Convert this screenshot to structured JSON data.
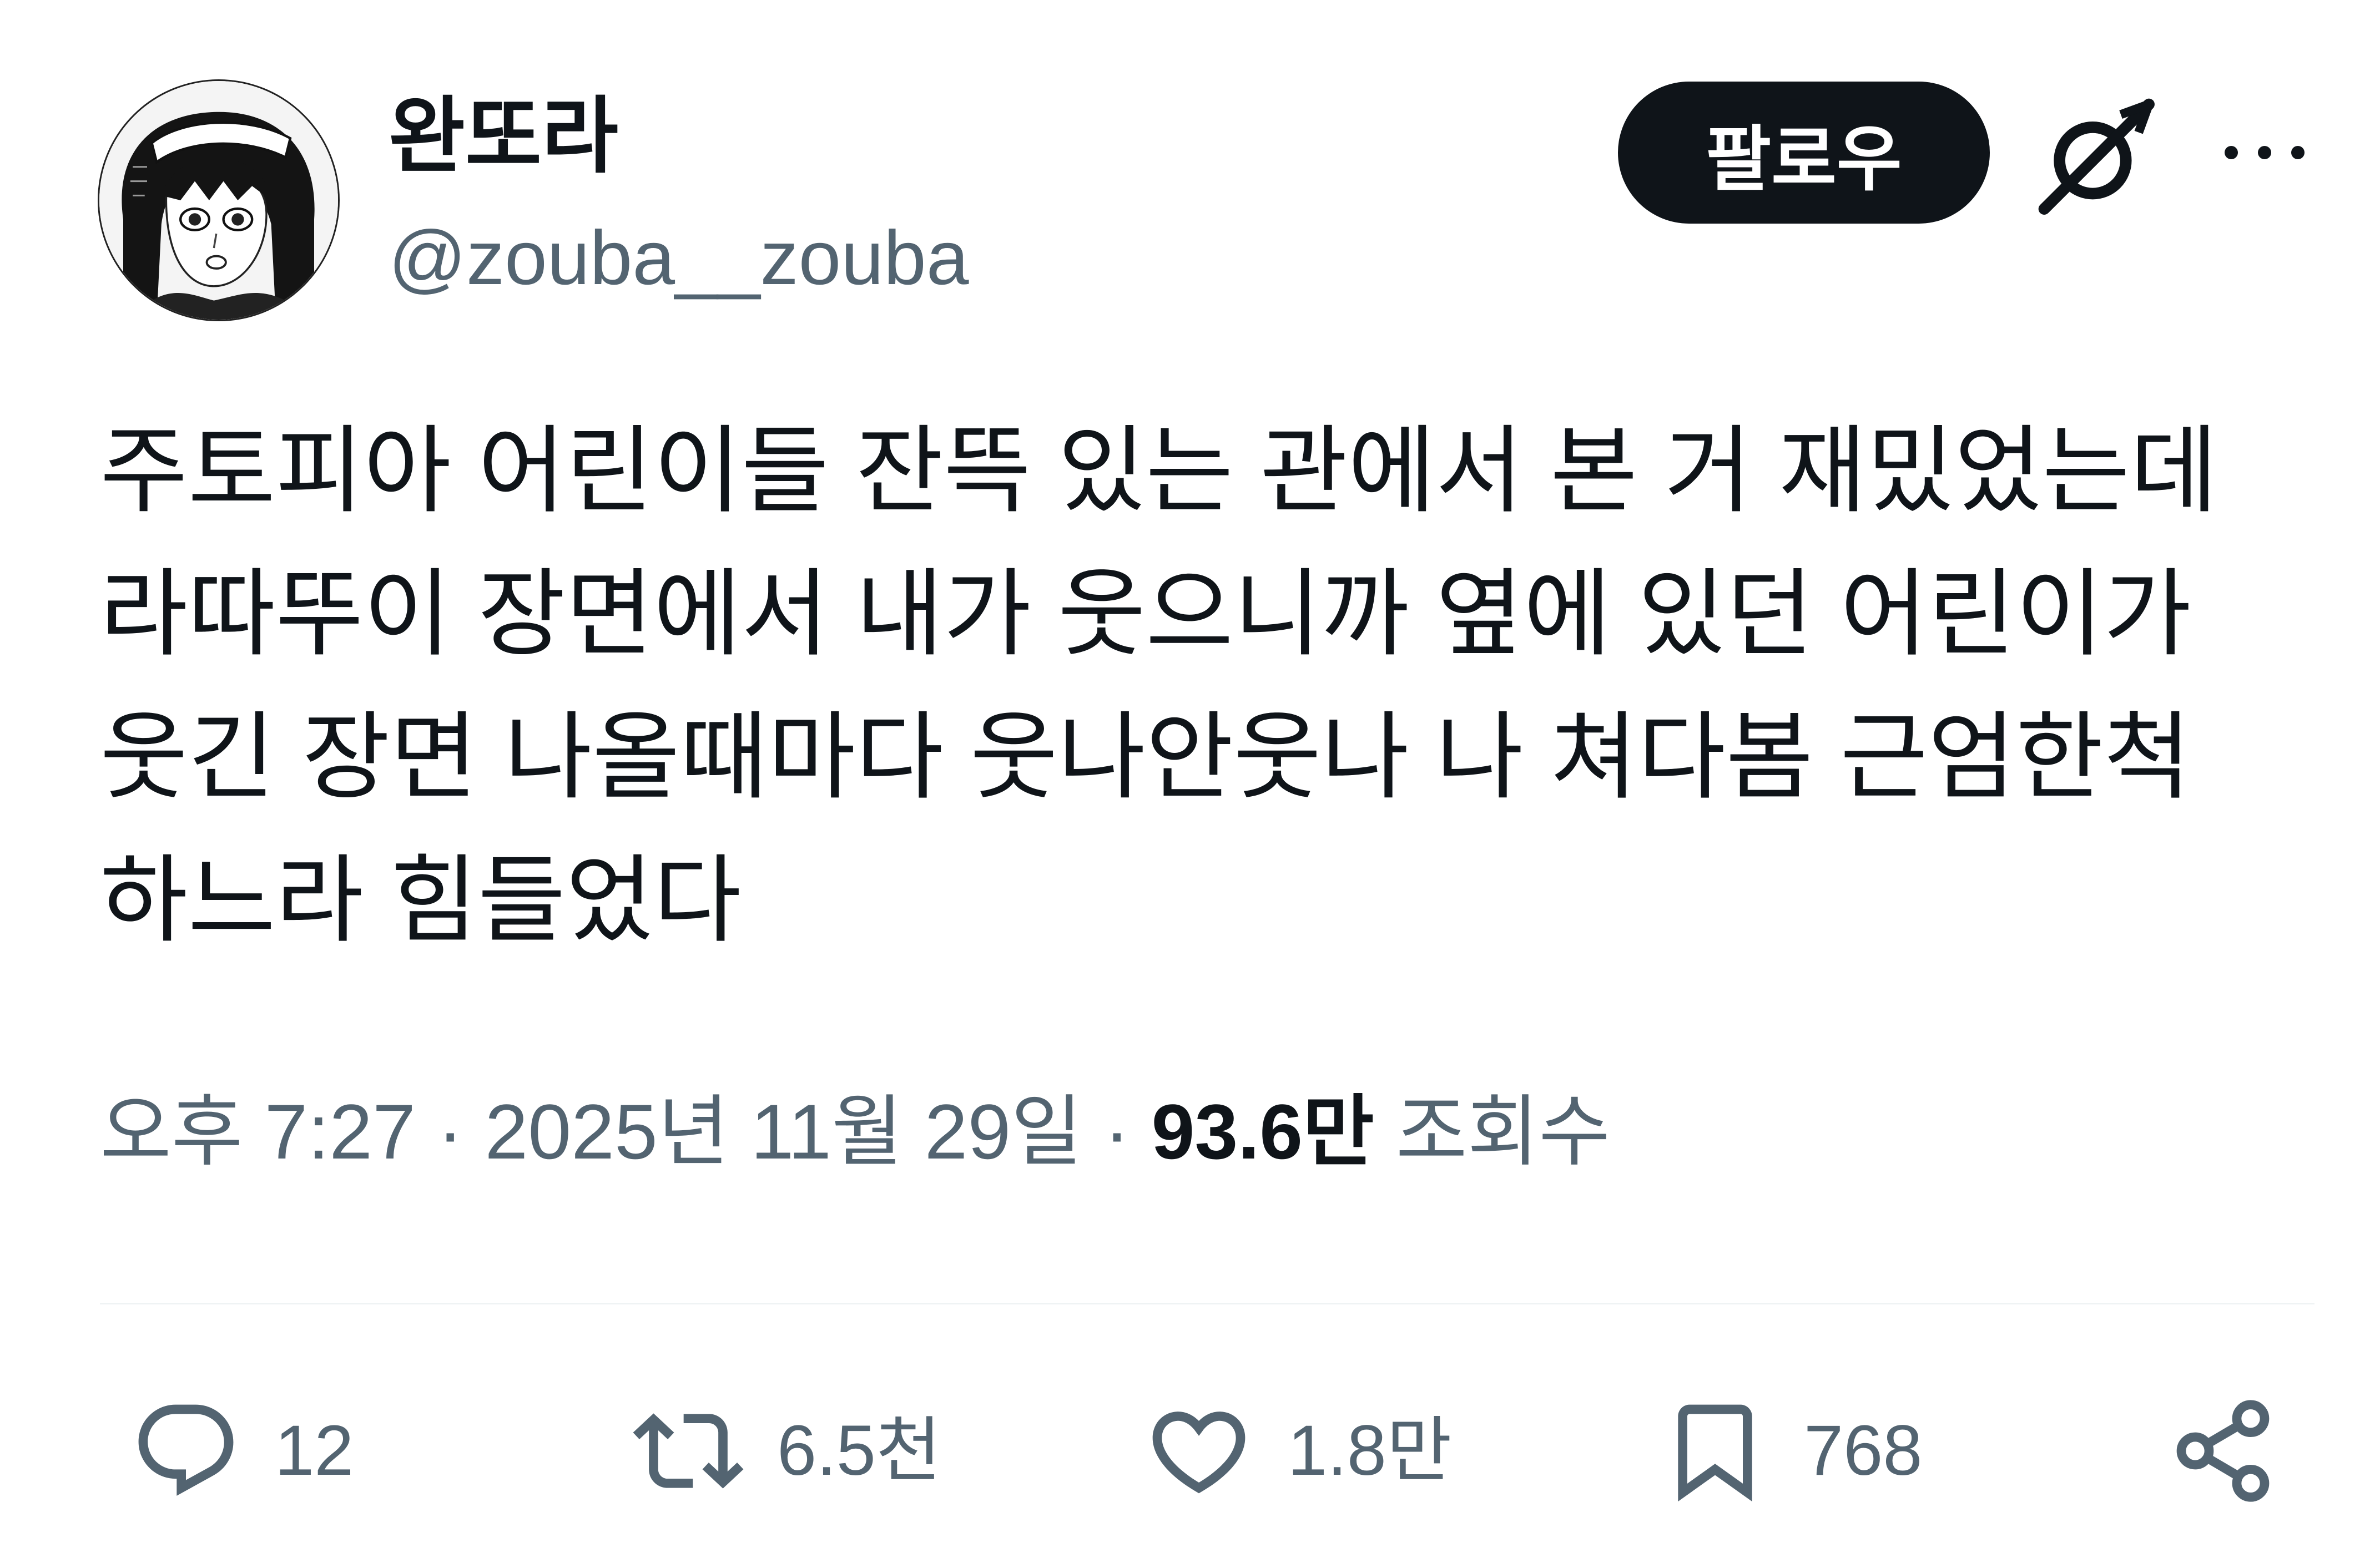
{
  "user": {
    "display_name": "완또라",
    "handle": "@zouba__zouba",
    "avatar_icon": "anime-avatar"
  },
  "header": {
    "follow_label": "팔로우",
    "grok_icon": "grok-icon",
    "more_icon": "more-horizontal-icon"
  },
  "tweet": {
    "lines": [
      "주토피아 어린이들 잔뜩 있는 관에서 본 거 재밌었는데",
      "라따뚜이 장면에서 내가 웃으니까 옆에 있던 어린이가",
      "웃긴 장면 나올때마다 웃나안웃나 나 쳐다봄 근엄한척",
      "하느라 힘들었다"
    ]
  },
  "meta": {
    "time": "오후 7:27",
    "separator": "·",
    "date": "2025년 11월 29일",
    "views_count": "93.6만",
    "views_label": "조회수"
  },
  "actions": {
    "reply": {
      "icon": "reply-icon",
      "count": "12"
    },
    "retweet": {
      "icon": "retweet-icon",
      "count": "6.5천"
    },
    "like": {
      "icon": "heart-icon",
      "count": "1.8만"
    },
    "bookmark": {
      "icon": "bookmark-icon",
      "count": "768"
    },
    "share": {
      "icon": "share-icon"
    }
  },
  "colors": {
    "text_primary": "#0f1419",
    "text_secondary": "#536471",
    "divider": "#eff3f4",
    "follow_bg": "#0f1419",
    "follow_text": "#ffffff"
  }
}
